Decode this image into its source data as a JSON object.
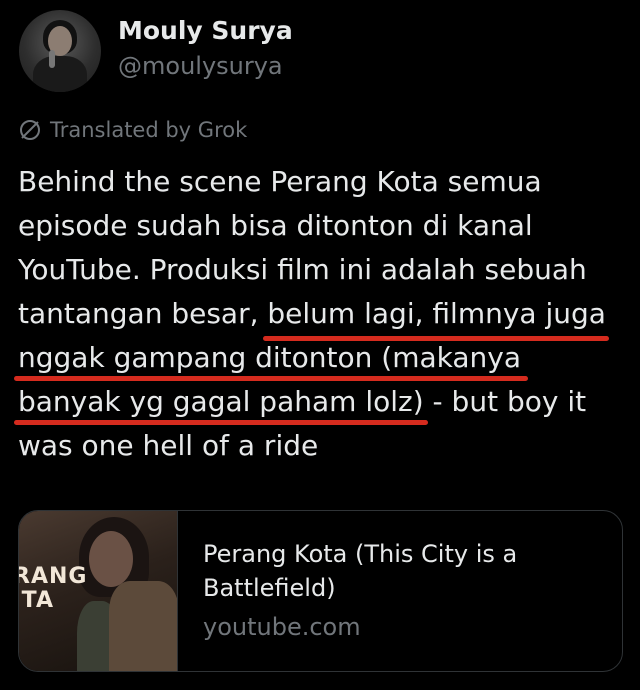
{
  "author": {
    "name": "Mouly Surya",
    "handle": "@moulysurya"
  },
  "translation": {
    "label": "Translated by Grok",
    "icon": "grok-slash-icon"
  },
  "tweet": {
    "lines": [
      "Behind the scene Perang Kota semua",
      "episode sudah bisa ditonton di kanal",
      "YouTube. Produksi film ini adalah sebuah",
      "tantangan besar, ",
      "belum lagi, filmnya juga",
      "nggak gampang ditonton (makanya",
      "banyak yg gagal paham lolz)",
      " - but boy it",
      "was one hell of a ride"
    ],
    "highlight_color": "#d52b1e"
  },
  "link_card": {
    "title": "Perang Kota (This City is a Battlefield)",
    "domain": "youtube.com",
    "thumbnail_text": "RANG\nTA"
  }
}
